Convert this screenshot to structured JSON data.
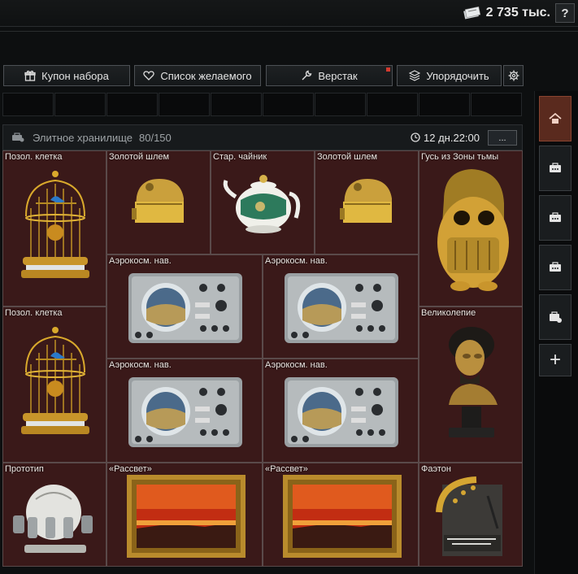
{
  "header": {
    "currency_amount": "2 735 тыс.",
    "currency_icon": "roubles-icon",
    "help_label": "?"
  },
  "toolbar": {
    "coupon_label": "Купон набора",
    "wishlist_label": "Список желаемого",
    "workbench_label": "Верстак",
    "sort_label": "Упорядочить",
    "notification_color": "#d23a2f"
  },
  "container": {
    "title": "Элитное хранилище",
    "capacity": "80/150",
    "timer": "12 дн.22:00",
    "more_label": "..."
  },
  "items": [
    {
      "name": "Позол. клетка"
    },
    {
      "name": "Золотой шлем"
    },
    {
      "name": "Стар. чайник"
    },
    {
      "name": "Золотой шлем"
    },
    {
      "name": "Гусь из Зоны тьмы"
    },
    {
      "name": "Аэрокосм. нав."
    },
    {
      "name": "Аэрокосм. нав."
    },
    {
      "name": "Позол. клетка"
    },
    {
      "name": "Великолепие"
    },
    {
      "name": "Аэрокосм. нав."
    },
    {
      "name": "Аэрокосм. нав."
    },
    {
      "name": "Прототип"
    },
    {
      "name": "«Рассвет»"
    },
    {
      "name": "«Рассвет»"
    },
    {
      "name": "Фаэтон"
    }
  ],
  "sidebar": {
    "add_label": "+"
  },
  "colors": {
    "accent": "#5a2a1e",
    "grid_bg": "#2b1414",
    "item_bg": "#3a1919"
  }
}
